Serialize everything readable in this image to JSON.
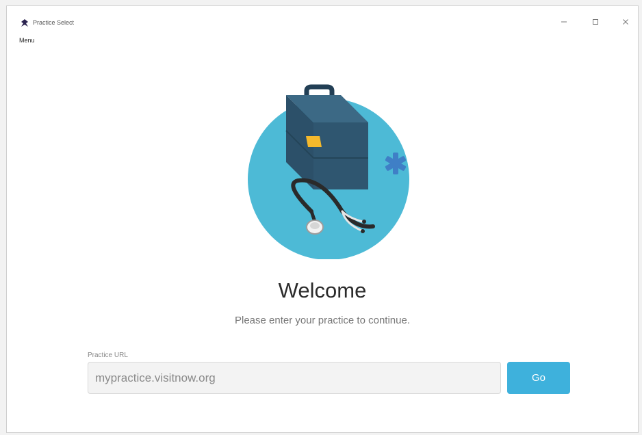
{
  "window": {
    "title": "Practice Select",
    "controls": {
      "minimize": "—",
      "maximize": "☐",
      "close": "✕"
    }
  },
  "menubar": {
    "menu_label": "Menu"
  },
  "hero": {
    "illustration": "medical-bag-stethoscope-illustration",
    "circle_color": "#4dbad6"
  },
  "main": {
    "heading": "Welcome",
    "subheading": "Please enter your practice to continue."
  },
  "form": {
    "url_label": "Practice URL",
    "url_value": "",
    "url_placeholder": "mypractice.visitnow.org",
    "go_label": "Go"
  },
  "colors": {
    "accent": "#3eb1dc",
    "bag": "#2f5670",
    "latch": "#f5b92c"
  }
}
